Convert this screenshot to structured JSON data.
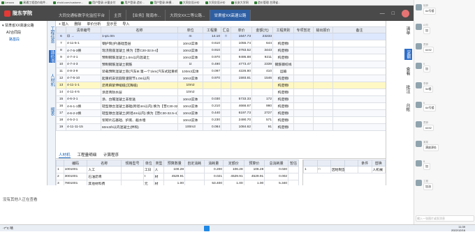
{
  "browser": {
    "bookmarks": [
      "Lenovo",
      "易通工程造价软件...",
      "zhcld.com/custome...",
      "用户登录-计量支付",
      "用户登录-造价...",
      "用户登录-纵横...",
      "大同交设计价",
      "大同交设计价",
      "长安大学网",
      "造价管理-甘肃省..."
    ]
  },
  "app": {
    "brand": "陇东学院",
    "tabs": [
      "大同交通标数字化监控平台",
      "主页",
      "【业务】陇南市...",
      "大同交XX二等公路...",
      "甘肃省XX高速公路"
    ]
  },
  "tree": {
    "root": "甘肃省XX高速公路",
    "items": [
      "A2合同段",
      "路基段"
    ]
  },
  "left_rail": [
    "工程信息",
    "造价书",
    "人材机",
    "报表"
  ],
  "toolbar": {
    "items": [
      "+ 插入",
      "删除",
      "单价分析",
      "显示至",
      "导入"
    ]
  },
  "grid": {
    "headers": [
      "",
      "清单编号",
      "名称",
      "单位",
      "工程量",
      "汇总",
      "单价",
      "金额(元)",
      "工程类别",
      "专项暂定",
      "输出报价",
      "备注"
    ],
    "rows": [
      {
        "n": "6",
        "code": "⊟ →",
        "name": "1-φ1.0m",
        "unit": "m",
        "qty": "14.10",
        "sum": "□",
        "price": "1647.73",
        "amt": "23233",
        "cat": "",
        "cls": "sel"
      },
      {
        "n": "7",
        "code": "4-11-5-1",
        "name": "钢护筒(护)基础垫层",
        "unit": "10m3实体",
        "qty": "0.610",
        "sum": "",
        "price": "1055.74",
        "amt": "644",
        "cat": "构造物Ⅰ",
        "cls": ""
      },
      {
        "n": "8",
        "code": "4-7-5-3换",
        "name": "现浇管座混凝土 换为【普C20-32.5-4】",
        "unit": "10m3实体",
        "qty": "0.910",
        "price": "3783.52",
        "amt": "3443",
        "cat": "构造物Ⅰ",
        "cls": "alt"
      },
      {
        "n": "9",
        "code": "4-7-4-1",
        "name": "预制钢筋混凝土1.0m以内混凝土",
        "unit": "10m3实体",
        "qty": "0.970",
        "price": "9495.88",
        "amt": "9211",
        "cat": "构造物Ⅰ",
        "cls": ""
      },
      {
        "n": "10",
        "code": "4-7-4-3",
        "name": "预制钢筋混凝土钢筋",
        "unit": "1t",
        "qty": "0.490",
        "price": "4773.47",
        "amt": "2339",
        "cat": "钢筋钢绞线",
        "cls": "alt"
      },
      {
        "n": "11",
        "code": "4-8-3-9",
        "name": "装载预制混凝土管(汽车8t 第一个1km(汽车式起重机装卸))",
        "unit": "100m3实体",
        "qty": "0.097",
        "price": "4226.80",
        "amt": "410",
        "cat": "运输",
        "cls": ""
      },
      {
        "n": "12",
        "code": "4-7-5-10",
        "name": "起重机安装圆管涵管节1.0m以内",
        "unit": "10m3实体",
        "qty": "0.970",
        "price": "1593.81",
        "amt": "1546",
        "cat": "构造物Ⅰ",
        "cls": "alt"
      },
      {
        "n": "13",
        "code": "4-11-1-1",
        "name": "沥青麻絮伸缩缝(沉降缝)",
        "unit": "10m2",
        "qty": "",
        "price": "",
        "amt": "",
        "cat": "构造物Ⅰ",
        "cls": "hl"
      },
      {
        "n": "14",
        "code": "4-11-4-5",
        "name": "涂沥青防水层",
        "unit": "10m2",
        "qty": "",
        "price": "",
        "amt": "",
        "cat": "构造物Ⅰ",
        "cls": ""
      },
      {
        "n": "15",
        "code": "4-6-3-1",
        "name": "涂、台帽混凝土非泵送",
        "unit": "10m3实体",
        "qty": "0.030",
        "price": "5733.33",
        "amt": "172",
        "cat": "构造物Ⅰ",
        "cls": "alt"
      },
      {
        "n": "16",
        "code": "4-6-1-1换",
        "name": "轻型墩台混凝土基础(跨径4m以内) 换为【普C30-32.5-4】",
        "unit": "10m3实体",
        "qty": "0.210",
        "price": "4666.67",
        "amt": "980",
        "cat": "构造物Ⅰ",
        "cls": ""
      },
      {
        "n": "17",
        "code": "4-6-2-2换",
        "name": "轻型墩台混凝土(跨径4m以内) 换为【普C30-32.5-4】",
        "unit": "10m3实体",
        "qty": "0.440",
        "price": "6197.73",
        "amt": "2727",
        "cat": "构造物Ⅰ",
        "cls": "alt"
      },
      {
        "n": "18",
        "code": "4-5-2-1",
        "name": "浆砌片石基础、护底、截水墙",
        "unit": "10m3实体",
        "qty": "0.230",
        "price": "2490.70",
        "amt": "571",
        "cat": "构造物Ⅰ",
        "cls": ""
      },
      {
        "n": "19",
        "code": "4-11-11-15",
        "name": "60m3/h以内混凝土(拌和)",
        "unit": "100m3",
        "qty": "0.084",
        "price": "1084.62",
        "amt": "91",
        "cat": "构造物Ⅰ",
        "cls": "alt"
      }
    ]
  },
  "right_rail": [
    "清单",
    "定额",
    "查看",
    "批注",
    "台帐"
  ],
  "lower": {
    "tabs": [
      "人材机",
      "工程量明细",
      "计算程序"
    ],
    "headers": [
      "",
      "编码",
      "名称",
      "规格型号",
      "单位",
      "类型",
      "预算数量",
      "自定消耗",
      "消耗量",
      "定额价",
      "预算价",
      "总消耗量",
      "暂估"
    ],
    "rows": [
      [
        "1",
        "1001001",
        "人工",
        "",
        "工日",
        "人",
        "100.28",
        "",
        "0.200",
        "106.28",
        "106.28",
        "0.020",
        ""
      ],
      [
        "2",
        "3001001",
        "石油沥青",
        "",
        "t",
        "材",
        "4529.91",
        "",
        "0.021",
        "4529.91",
        "4529.91",
        "0.002",
        ""
      ],
      [
        "3",
        "7801001",
        "其他材料费",
        "",
        "元",
        "材",
        "1.00",
        "",
        "53.400",
        "1.00",
        "1.00",
        "5.340",
        ""
      ]
    ],
    "side_headers": [
      "",
      "",
      "",
      "",
      "条件",
      "替换"
    ],
    "side_rows": [
      [
        "1",
        "□",
        "因地制宜",
        "",
        "",
        "人机械"
      ]
    ]
  },
  "status": {
    "left": "没有其他人正在查看"
  },
  "taskbar": {
    "weather": "-7°C 晴",
    "time": "11:39",
    "date": "2022/12/16"
  },
  "chat": {
    "messages": [
      {
        "name": "徐渺",
        "text": "6#号楼"
      },
      {
        "name": "A 何",
        "text": "加"
      },
      {
        "name": "贾渺",
        "text": "6492"
      },
      {
        "name": "9",
        "text": "加"
      },
      {
        "name": "李渺",
        "text": "5#楼"
      },
      {
        "name": "6",
        "text": "6#号楼"
      },
      {
        "name": "贾渺",
        "text": "6492"
      },
      {
        "name": "某某",
        "text": "满座源处"
      },
      {
        "name": "B",
        "text": "加"
      },
      {
        "name": "工程",
        "text": "加油"
      }
    ],
    "input": "输入一张图片或发消息"
  }
}
